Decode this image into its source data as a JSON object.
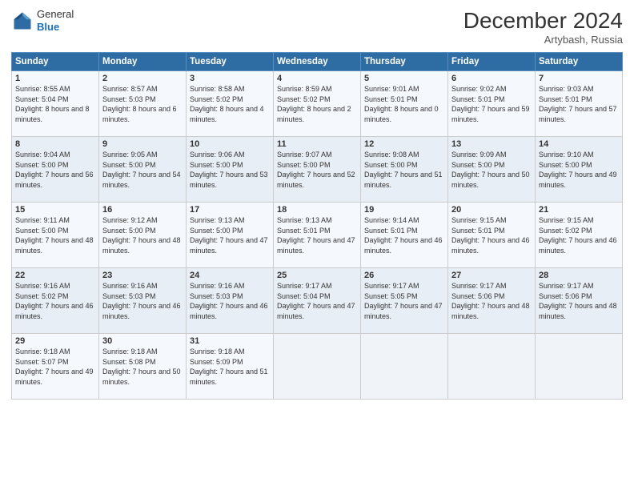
{
  "header": {
    "logo_general": "General",
    "logo_blue": "Blue",
    "month_title": "December 2024",
    "location": "Artybash, Russia"
  },
  "weekdays": [
    "Sunday",
    "Monday",
    "Tuesday",
    "Wednesday",
    "Thursday",
    "Friday",
    "Saturday"
  ],
  "weeks": [
    [
      {
        "day": "1",
        "sunrise": "Sunrise: 8:55 AM",
        "sunset": "Sunset: 5:04 PM",
        "daylight": "Daylight: 8 hours and 8 minutes."
      },
      {
        "day": "2",
        "sunrise": "Sunrise: 8:57 AM",
        "sunset": "Sunset: 5:03 PM",
        "daylight": "Daylight: 8 hours and 6 minutes."
      },
      {
        "day": "3",
        "sunrise": "Sunrise: 8:58 AM",
        "sunset": "Sunset: 5:02 PM",
        "daylight": "Daylight: 8 hours and 4 minutes."
      },
      {
        "day": "4",
        "sunrise": "Sunrise: 8:59 AM",
        "sunset": "Sunset: 5:02 PM",
        "daylight": "Daylight: 8 hours and 2 minutes."
      },
      {
        "day": "5",
        "sunrise": "Sunrise: 9:01 AM",
        "sunset": "Sunset: 5:01 PM",
        "daylight": "Daylight: 8 hours and 0 minutes."
      },
      {
        "day": "6",
        "sunrise": "Sunrise: 9:02 AM",
        "sunset": "Sunset: 5:01 PM",
        "daylight": "Daylight: 7 hours and 59 minutes."
      },
      {
        "day": "7",
        "sunrise": "Sunrise: 9:03 AM",
        "sunset": "Sunset: 5:01 PM",
        "daylight": "Daylight: 7 hours and 57 minutes."
      }
    ],
    [
      {
        "day": "8",
        "sunrise": "Sunrise: 9:04 AM",
        "sunset": "Sunset: 5:00 PM",
        "daylight": "Daylight: 7 hours and 56 minutes."
      },
      {
        "day": "9",
        "sunrise": "Sunrise: 9:05 AM",
        "sunset": "Sunset: 5:00 PM",
        "daylight": "Daylight: 7 hours and 54 minutes."
      },
      {
        "day": "10",
        "sunrise": "Sunrise: 9:06 AM",
        "sunset": "Sunset: 5:00 PM",
        "daylight": "Daylight: 7 hours and 53 minutes."
      },
      {
        "day": "11",
        "sunrise": "Sunrise: 9:07 AM",
        "sunset": "Sunset: 5:00 PM",
        "daylight": "Daylight: 7 hours and 52 minutes."
      },
      {
        "day": "12",
        "sunrise": "Sunrise: 9:08 AM",
        "sunset": "Sunset: 5:00 PM",
        "daylight": "Daylight: 7 hours and 51 minutes."
      },
      {
        "day": "13",
        "sunrise": "Sunrise: 9:09 AM",
        "sunset": "Sunset: 5:00 PM",
        "daylight": "Daylight: 7 hours and 50 minutes."
      },
      {
        "day": "14",
        "sunrise": "Sunrise: 9:10 AM",
        "sunset": "Sunset: 5:00 PM",
        "daylight": "Daylight: 7 hours and 49 minutes."
      }
    ],
    [
      {
        "day": "15",
        "sunrise": "Sunrise: 9:11 AM",
        "sunset": "Sunset: 5:00 PM",
        "daylight": "Daylight: 7 hours and 48 minutes."
      },
      {
        "day": "16",
        "sunrise": "Sunrise: 9:12 AM",
        "sunset": "Sunset: 5:00 PM",
        "daylight": "Daylight: 7 hours and 48 minutes."
      },
      {
        "day": "17",
        "sunrise": "Sunrise: 9:13 AM",
        "sunset": "Sunset: 5:00 PM",
        "daylight": "Daylight: 7 hours and 47 minutes."
      },
      {
        "day": "18",
        "sunrise": "Sunrise: 9:13 AM",
        "sunset": "Sunset: 5:01 PM",
        "daylight": "Daylight: 7 hours and 47 minutes."
      },
      {
        "day": "19",
        "sunrise": "Sunrise: 9:14 AM",
        "sunset": "Sunset: 5:01 PM",
        "daylight": "Daylight: 7 hours and 46 minutes."
      },
      {
        "day": "20",
        "sunrise": "Sunrise: 9:15 AM",
        "sunset": "Sunset: 5:01 PM",
        "daylight": "Daylight: 7 hours and 46 minutes."
      },
      {
        "day": "21",
        "sunrise": "Sunrise: 9:15 AM",
        "sunset": "Sunset: 5:02 PM",
        "daylight": "Daylight: 7 hours and 46 minutes."
      }
    ],
    [
      {
        "day": "22",
        "sunrise": "Sunrise: 9:16 AM",
        "sunset": "Sunset: 5:02 PM",
        "daylight": "Daylight: 7 hours and 46 minutes."
      },
      {
        "day": "23",
        "sunrise": "Sunrise: 9:16 AM",
        "sunset": "Sunset: 5:03 PM",
        "daylight": "Daylight: 7 hours and 46 minutes."
      },
      {
        "day": "24",
        "sunrise": "Sunrise: 9:16 AM",
        "sunset": "Sunset: 5:03 PM",
        "daylight": "Daylight: 7 hours and 46 minutes."
      },
      {
        "day": "25",
        "sunrise": "Sunrise: 9:17 AM",
        "sunset": "Sunset: 5:04 PM",
        "daylight": "Daylight: 7 hours and 47 minutes."
      },
      {
        "day": "26",
        "sunrise": "Sunrise: 9:17 AM",
        "sunset": "Sunset: 5:05 PM",
        "daylight": "Daylight: 7 hours and 47 minutes."
      },
      {
        "day": "27",
        "sunrise": "Sunrise: 9:17 AM",
        "sunset": "Sunset: 5:06 PM",
        "daylight": "Daylight: 7 hours and 48 minutes."
      },
      {
        "day": "28",
        "sunrise": "Sunrise: 9:17 AM",
        "sunset": "Sunset: 5:06 PM",
        "daylight": "Daylight: 7 hours and 48 minutes."
      }
    ],
    [
      {
        "day": "29",
        "sunrise": "Sunrise: 9:18 AM",
        "sunset": "Sunset: 5:07 PM",
        "daylight": "Daylight: 7 hours and 49 minutes."
      },
      {
        "day": "30",
        "sunrise": "Sunrise: 9:18 AM",
        "sunset": "Sunset: 5:08 PM",
        "daylight": "Daylight: 7 hours and 50 minutes."
      },
      {
        "day": "31",
        "sunrise": "Sunrise: 9:18 AM",
        "sunset": "Sunset: 5:09 PM",
        "daylight": "Daylight: 7 hours and 51 minutes."
      },
      null,
      null,
      null,
      null
    ]
  ]
}
